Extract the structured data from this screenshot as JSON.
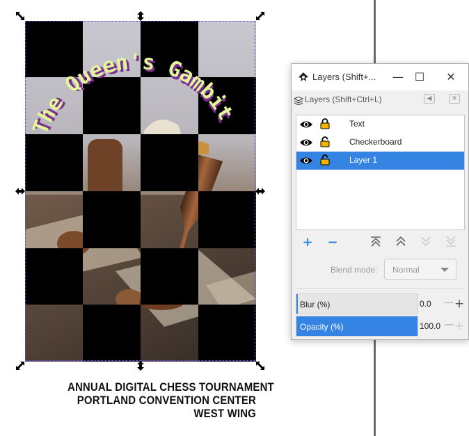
{
  "poster": {
    "headline": "The Queen's Gambit",
    "caption": [
      "ANNUAL DIGITAL CHESS TOURNAMENT",
      "PORTLAND CONVENTION CENTER",
      "WEST WING"
    ]
  },
  "dialog": {
    "window_title": "Layers (Shift+...",
    "panel_title": "Layers (Shift+Ctrl+L)",
    "layers": [
      {
        "name": "Text",
        "visible": true,
        "locked": true,
        "selected": false
      },
      {
        "name": "Checkerboard",
        "visible": true,
        "locked": false,
        "selected": false
      },
      {
        "name": "Layer 1",
        "visible": true,
        "locked": false,
        "selected": true
      }
    ],
    "blend_mode_label": "Blend mode:",
    "blend_mode_value": "Normal",
    "blur": {
      "label": "Blur (%)",
      "value": "0.0",
      "fraction": 0.0
    },
    "opacity": {
      "label": "Opacity (%)",
      "value": "100.0",
      "fraction": 1.0
    }
  },
  "colors": {
    "accent": "#3584e4",
    "headline_fill": "#e3f59a",
    "headline_shadow": "#7b2d8e"
  },
  "icons": [
    "eye-icon",
    "lock-icon",
    "unlock-icon",
    "add-layer-icon",
    "remove-layer-icon",
    "raise-to-top-icon",
    "raise-layer-icon",
    "lower-layer-icon",
    "lower-to-bottom-icon"
  ]
}
